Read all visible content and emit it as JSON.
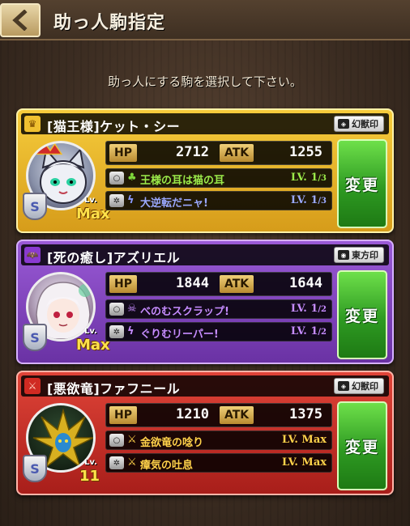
{
  "header": {
    "title": "助っ人駒指定",
    "back_icon": "chevron-left-icon"
  },
  "instruction": "助っ人にする駒を選択して下さい。",
  "cards": [
    {
      "theme": "gold",
      "name": "[猫王様]ケット・シー",
      "seal": "幻獣印",
      "attr_icon": "crown-icon",
      "shield": "S",
      "lv_label": "Lv.",
      "lv_value": "Max",
      "hp_label": "HP",
      "hp": "2712",
      "atk_label": "ATK",
      "atk": "1255",
      "skills": [
        {
          "type": "○",
          "icon": "♣",
          "name": "王様の耳は猫の耳",
          "lv": "LV. 1",
          "lv_max": "/3"
        },
        {
          "type": "✲",
          "icon": "ϟ",
          "name": "大逆転だニャ!",
          "lv": "LV. 1",
          "lv_max": "/3"
        }
      ],
      "button": "変更"
    },
    {
      "theme": "purple",
      "name": "[死の癒し]アズリエル",
      "seal": "東方印",
      "attr_icon": "bat-icon",
      "shield": "S",
      "lv_label": "Lv.",
      "lv_value": "Max",
      "hp_label": "HP",
      "hp": "1844",
      "atk_label": "ATK",
      "atk": "1644",
      "skills": [
        {
          "type": "○",
          "icon": "☠",
          "name": "べのむスクラップ!",
          "lv": "LV. 1",
          "lv_max": "/2"
        },
        {
          "type": "✲",
          "icon": "ϟ",
          "name": "ぐりむリーパー!",
          "lv": "LV. 1",
          "lv_max": "/2"
        }
      ],
      "button": "変更"
    },
    {
      "theme": "red",
      "name": "[悪欲竜]ファフニール",
      "seal": "幻獣印",
      "attr_icon": "sword-icon",
      "shield": "S",
      "lv_label": "Lv.",
      "lv_value": "11",
      "hp_label": "HP",
      "hp": "1210",
      "atk_label": "ATK",
      "atk": "1375",
      "skills": [
        {
          "type": "○",
          "icon": "⚔",
          "name": "金欲竜の唸り",
          "lv": "LV. Max",
          "lv_max": ""
        },
        {
          "type": "✲",
          "icon": "⚔",
          "name": "瘴気の吐息",
          "lv": "LV. Max",
          "lv_max": ""
        }
      ],
      "button": "変更"
    }
  ]
}
